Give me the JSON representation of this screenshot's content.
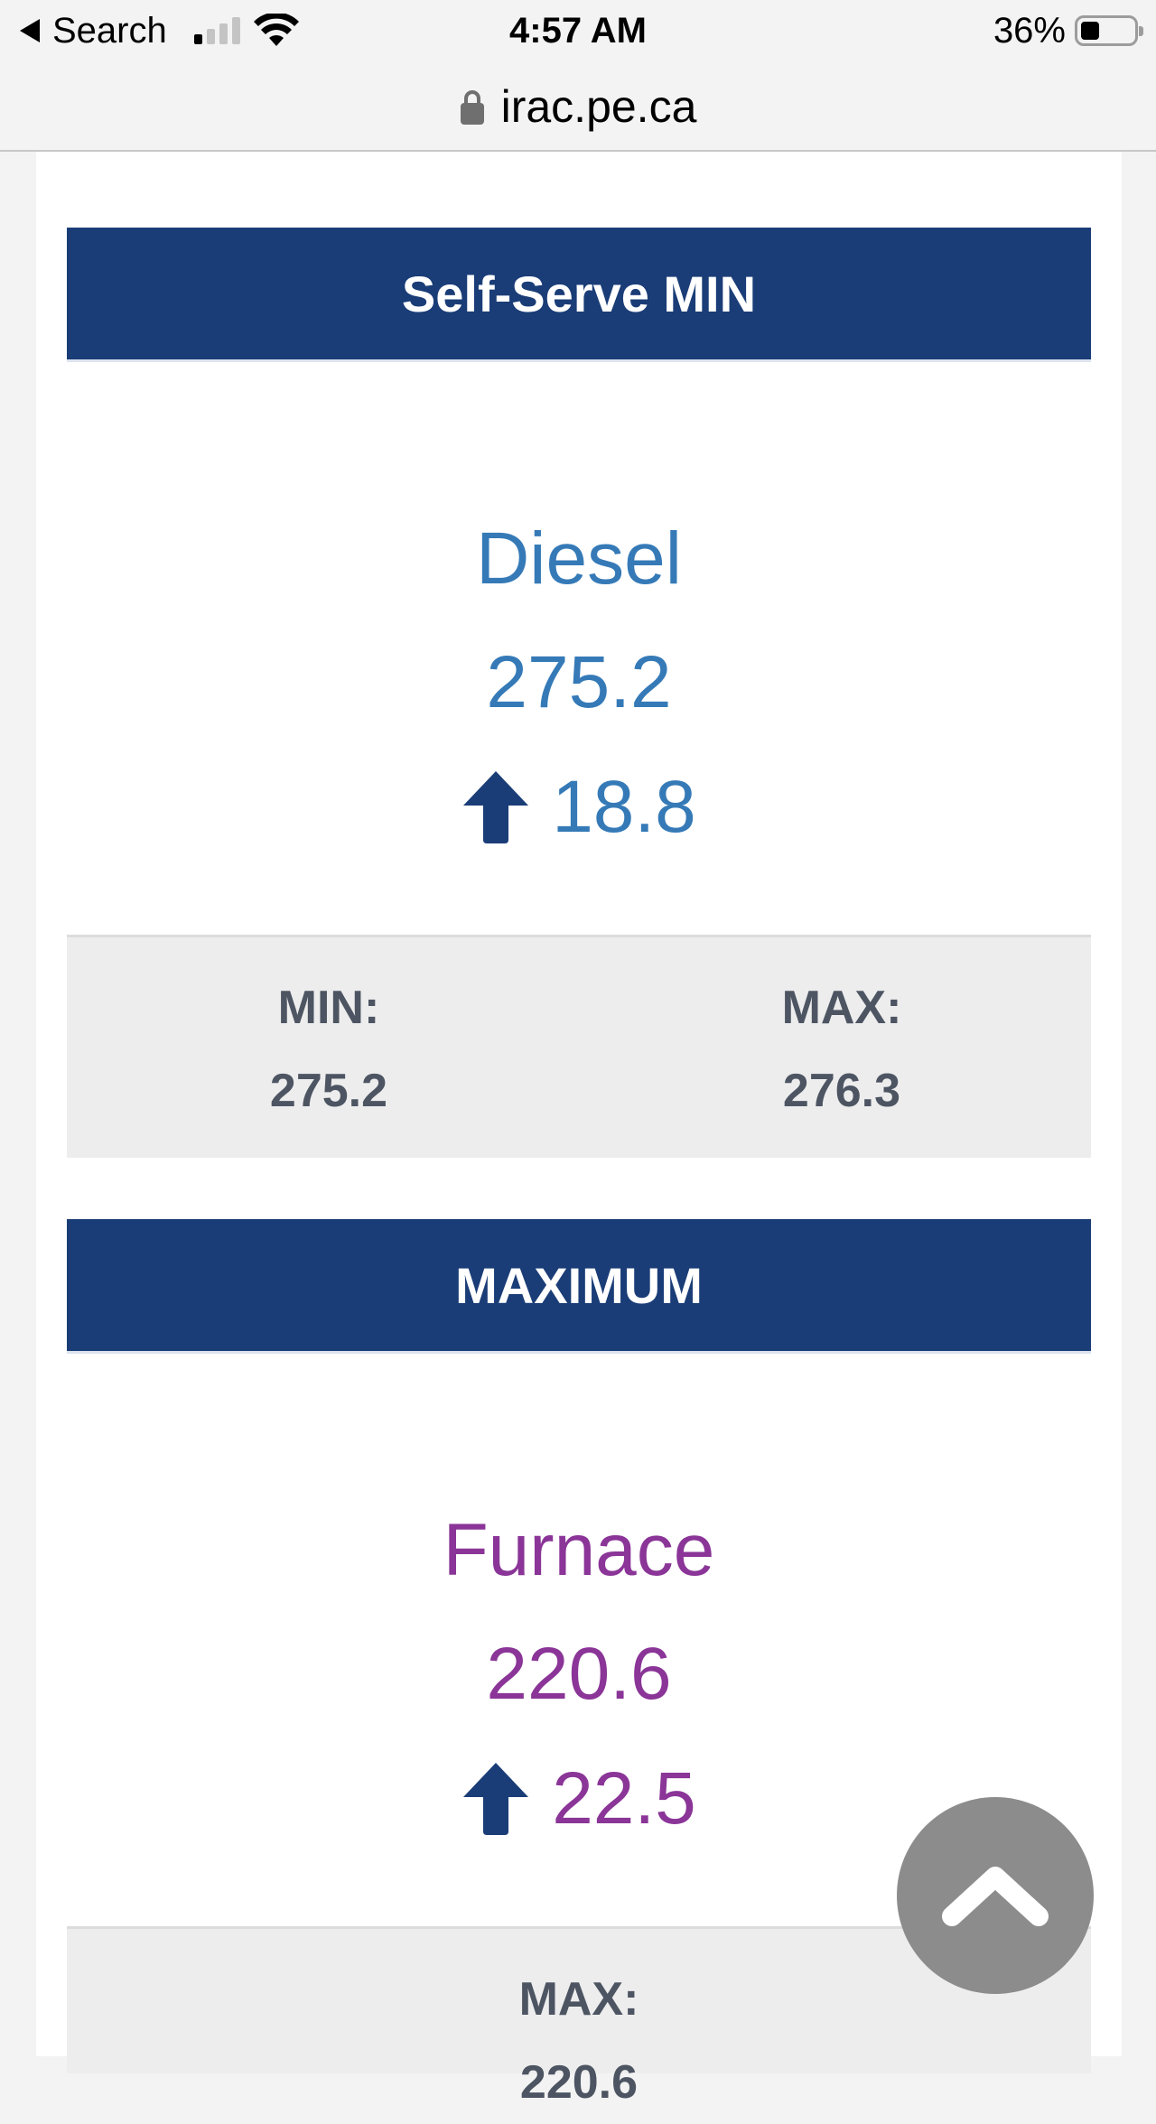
{
  "status_bar": {
    "back_label": "Search",
    "time": "4:57 AM",
    "battery_text": "36%",
    "battery_level": 0.36,
    "signal_bars_on": 1,
    "signal_bars_total": 4
  },
  "browser": {
    "url": "irac.pe.ca"
  },
  "panels": [
    {
      "header": "Self-Serve MIN",
      "fuel": "Diesel",
      "price": "275.2",
      "change": "18.8",
      "change_direction": "up",
      "accent": "#357ab7",
      "min_label": "MIN:",
      "min_value": "275.2",
      "max_label": "MAX:",
      "max_value": "276.3"
    },
    {
      "header": "MAXIMUM",
      "fuel": "Furnace",
      "price": "220.6",
      "change": "22.5",
      "change_direction": "up",
      "accent": "#8a3597",
      "max_label": "MAX:",
      "max_value": "220.6"
    }
  ],
  "colors": {
    "header_bg": "#1a3d77",
    "arrow": "#1a3d77",
    "minmax_bg": "#ededed",
    "scroll_button": "#8c8c8c"
  },
  "icons": {
    "back": "back-triangle-icon",
    "signal": "cellular-signal-icon",
    "wifi": "wifi-icon",
    "battery": "battery-icon",
    "lock": "lock-icon",
    "arrow_up": "arrow-up-icon",
    "scroll_top": "chevron-up-icon"
  }
}
